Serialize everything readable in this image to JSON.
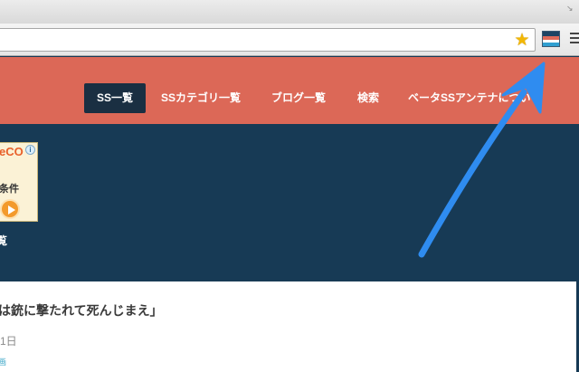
{
  "browser": {
    "resize_icon": "↘",
    "star_glyph": "★",
    "extension_icon": "extension-icon"
  },
  "nav": {
    "items": [
      {
        "label": "SS一覧",
        "active": true
      },
      {
        "label": "SSカテゴリ一覧",
        "active": false
      },
      {
        "label": "ブログ一覧",
        "active": false
      },
      {
        "label": "検索",
        "active": false
      },
      {
        "label": "ベータSSアンテナについて",
        "active": false
      }
    ]
  },
  "ad": {
    "brand": "eCO",
    "info_glyph": "i",
    "text": "条件"
  },
  "side": {
    "label": "覧"
  },
  "article": {
    "title": "は銃に撃たれて死んじまえ」",
    "date": "1日",
    "category": "画"
  },
  "colors": {
    "nav_bg": "#dc6857",
    "page_bg": "#173a55",
    "active_tab": "#1a2f42",
    "arrow": "#2f8cf0"
  }
}
